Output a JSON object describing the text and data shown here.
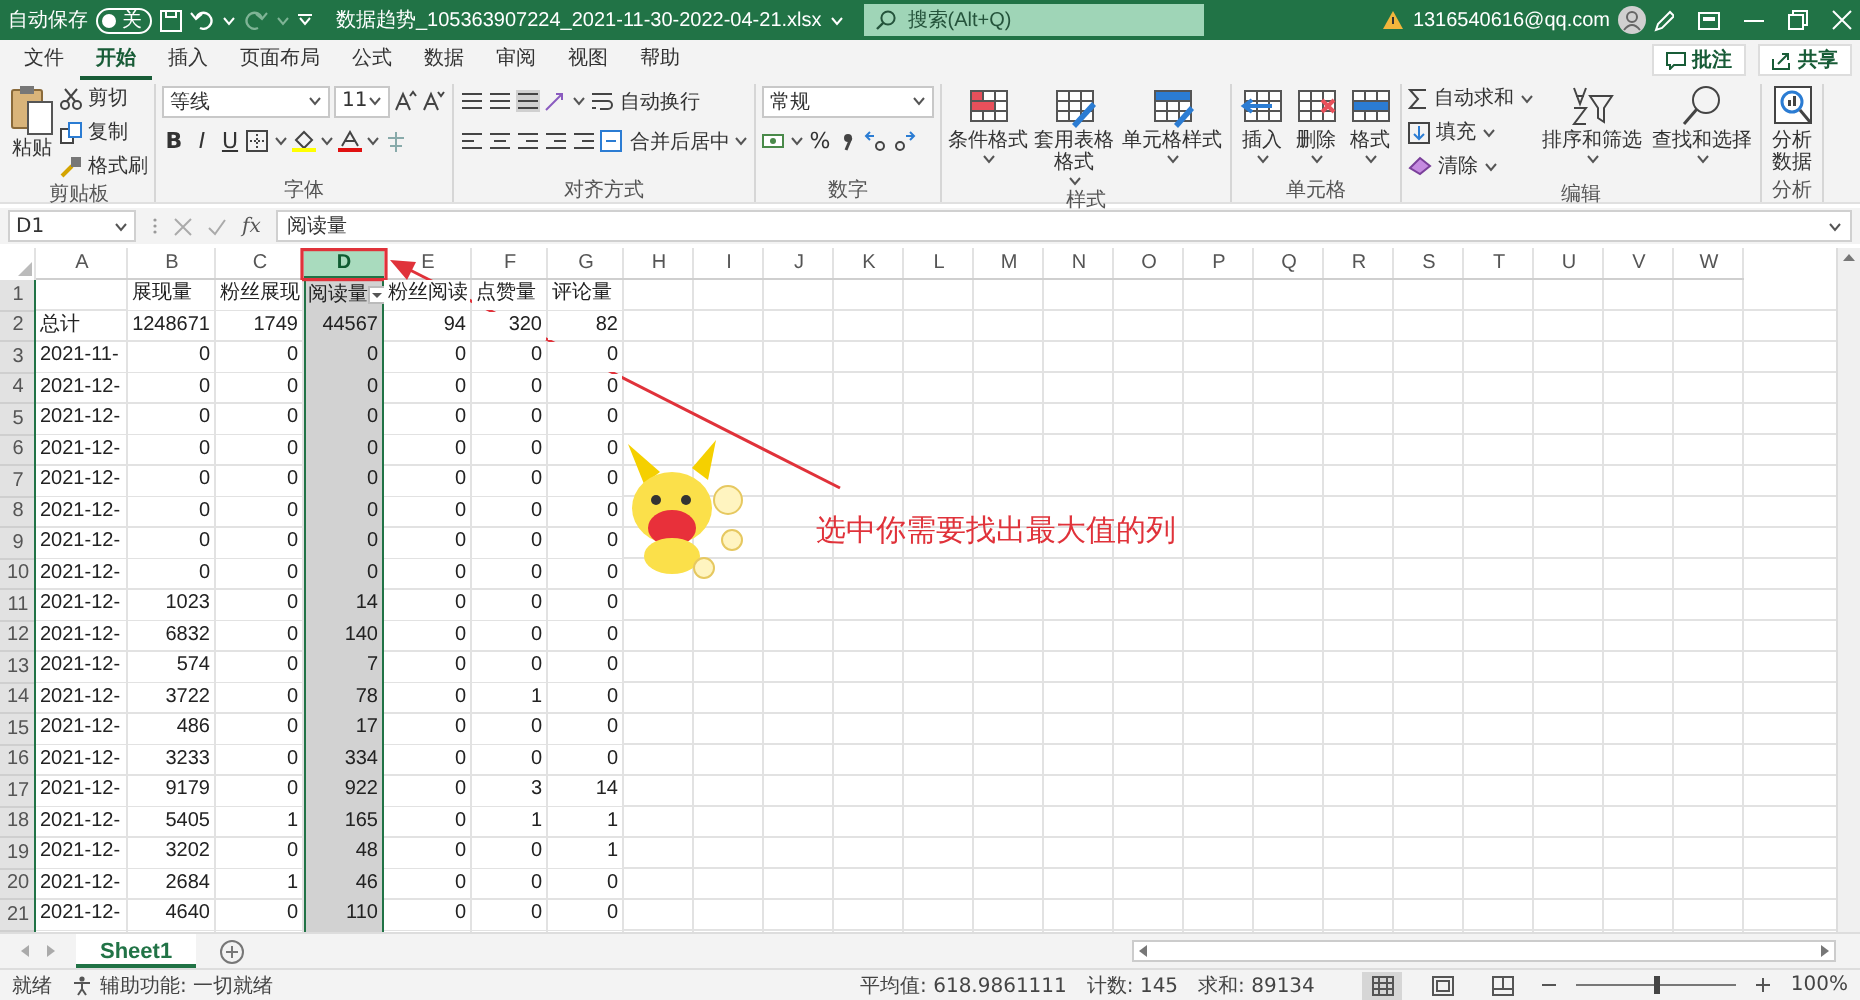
{
  "title_bar": {
    "autosave_label": "自动保存",
    "autosave": {
      "on": false,
      "label": "关"
    },
    "file_name": "数据趋势_105363907224_2021-11-30-2022-04-21.xlsx",
    "search": {
      "placeholder": "搜索(Alt+Q)"
    },
    "account": "1316540616@qq.com"
  },
  "ribbon_tabs": [
    {
      "label": "文件",
      "selected": false
    },
    {
      "label": "开始",
      "selected": true
    },
    {
      "label": "插入",
      "selected": false
    },
    {
      "label": "页面布局",
      "selected": false
    },
    {
      "label": "公式",
      "selected": false
    },
    {
      "label": "数据",
      "selected": false
    },
    {
      "label": "审阅",
      "selected": false
    },
    {
      "label": "视图",
      "selected": false
    },
    {
      "label": "帮助",
      "selected": false
    }
  ],
  "ribbon_actions": [
    "批注",
    "共享"
  ],
  "ribbon": {
    "groups": [
      {
        "kind": "clipboard",
        "name": "剪贴板",
        "large": "粘贴",
        "small": [
          "剪切",
          "复制",
          "格式刷"
        ]
      },
      {
        "kind": "font",
        "name": "字体",
        "font": "等线",
        "size": "11",
        "styles": [
          "B",
          "I",
          "U"
        ]
      },
      {
        "kind": "alignment",
        "name": "对齐方式",
        "small": [
          "自动换行",
          "合并后居中"
        ]
      },
      {
        "kind": "number",
        "name": "数字",
        "format": "常规",
        "symbols": [
          "%"
        ]
      },
      {
        "kind": "styles",
        "name": "样式",
        "large": [
          "条件格式",
          "套用表格格式",
          "单元格样式"
        ]
      },
      {
        "kind": "cells",
        "name": "单元格",
        "large": [
          "插入",
          "删除",
          "格式"
        ]
      },
      {
        "kind": "editing",
        "name": "编辑",
        "small": [
          "自动求和",
          "填充",
          "清除"
        ],
        "large": [
          "排序和筛选",
          "查找和选择"
        ]
      },
      {
        "kind": "analysis",
        "name": "分析",
        "large": [
          "分析数据"
        ]
      }
    ]
  },
  "formula_bar": {
    "name_box": "D1",
    "function_label": "fx",
    "content": "阅读量"
  },
  "sheet": {
    "columns": [
      {
        "letter": "A",
        "selected": false
      },
      {
        "letter": "B",
        "selected": false
      },
      {
        "letter": "C",
        "selected": false
      },
      {
        "letter": "D",
        "selected": true,
        "filter": true
      },
      {
        "letter": "E",
        "selected": false
      },
      {
        "letter": "F",
        "selected": false
      },
      {
        "letter": "G",
        "selected": false
      },
      {
        "letter": "H",
        "selected": false
      },
      {
        "letter": "I",
        "selected": false
      },
      {
        "letter": "J",
        "selected": false
      },
      {
        "letter": "K",
        "selected": false
      },
      {
        "letter": "L",
        "selected": false
      },
      {
        "letter": "M",
        "selected": false
      },
      {
        "letter": "N",
        "selected": false
      },
      {
        "letter": "O",
        "selected": false
      },
      {
        "letter": "P",
        "selected": false
      },
      {
        "letter": "Q",
        "selected": false
      },
      {
        "letter": "R",
        "selected": false
      },
      {
        "letter": "S",
        "selected": false
      },
      {
        "letter": "T",
        "selected": false
      },
      {
        "letter": "U",
        "selected": false
      },
      {
        "letter": "V",
        "selected": false
      },
      {
        "letter": "W",
        "selected": false
      }
    ],
    "rows": [
      {
        "number": "1",
        "kind": "header",
        "values": [
          "展现量",
          "粉丝展现",
          "阅读量",
          "粉丝阅读",
          "点赞量",
          "评论量"
        ]
      },
      {
        "number": "2",
        "kind": "data",
        "label": "总计",
        "values": [
          "1248671",
          "1749",
          "44567",
          "94",
          "320",
          "82"
        ]
      },
      {
        "number": "3",
        "kind": "data",
        "label": "2021-11-",
        "values": [
          "0",
          "0",
          "0",
          "0",
          "0",
          "0"
        ]
      },
      {
        "number": "4",
        "kind": "data",
        "label": "2021-12-",
        "values": [
          "0",
          "0",
          "0",
          "0",
          "0",
          "0"
        ]
      },
      {
        "number": "5",
        "kind": "data",
        "label": "2021-12-",
        "values": [
          "0",
          "0",
          "0",
          "0",
          "0",
          "0"
        ]
      },
      {
        "number": "6",
        "kind": "data",
        "label": "2021-12-",
        "values": [
          "0",
          "0",
          "0",
          "0",
          "0",
          "0"
        ]
      },
      {
        "number": "7",
        "kind": "data",
        "label": "2021-12-",
        "values": [
          "0",
          "0",
          "0",
          "0",
          "0",
          "0"
        ]
      },
      {
        "number": "8",
        "kind": "data",
        "label": "2021-12-",
        "values": [
          "0",
          "0",
          "0",
          "0",
          "0",
          "0"
        ]
      },
      {
        "number": "9",
        "kind": "data",
        "label": "2021-12-",
        "values": [
          "0",
          "0",
          "0",
          "0",
          "0",
          "0"
        ]
      },
      {
        "number": "10",
        "kind": "data",
        "label": "2021-12-",
        "values": [
          "0",
          "0",
          "0",
          "0",
          "0",
          "0"
        ]
      },
      {
        "number": "11",
        "kind": "data",
        "label": "2021-12-",
        "values": [
          "1023",
          "0",
          "14",
          "0",
          "0",
          "0"
        ]
      },
      {
        "number": "12",
        "kind": "data",
        "label": "2021-12-",
        "values": [
          "6832",
          "0",
          "140",
          "0",
          "0",
          "0"
        ]
      },
      {
        "number": "13",
        "kind": "data",
        "label": "2021-12-",
        "values": [
          "574",
          "0",
          "7",
          "0",
          "0",
          "0"
        ]
      },
      {
        "number": "14",
        "kind": "data",
        "label": "2021-12-",
        "values": [
          "3722",
          "0",
          "78",
          "0",
          "1",
          "0"
        ]
      },
      {
        "number": "15",
        "kind": "data",
        "label": "2021-12-",
        "values": [
          "486",
          "0",
          "17",
          "0",
          "0",
          "0"
        ]
      },
      {
        "number": "16",
        "kind": "data",
        "label": "2021-12-",
        "values": [
          "3233",
          "0",
          "334",
          "0",
          "0",
          "0"
        ]
      },
      {
        "number": "17",
        "kind": "data",
        "label": "2021-12-",
        "values": [
          "9179",
          "0",
          "922",
          "0",
          "3",
          "14"
        ]
      },
      {
        "number": "18",
        "kind": "data",
        "label": "2021-12-",
        "values": [
          "5405",
          "1",
          "165",
          "0",
          "1",
          "1"
        ]
      },
      {
        "number": "19",
        "kind": "data",
        "label": "2021-12-",
        "values": [
          "3202",
          "0",
          "48",
          "0",
          "0",
          "1"
        ]
      },
      {
        "number": "20",
        "kind": "data",
        "label": "2021-12-",
        "values": [
          "2684",
          "1",
          "46",
          "0",
          "0",
          "0"
        ]
      },
      {
        "number": "21",
        "kind": "data",
        "label": "2021-12-",
        "values": [
          "4640",
          "0",
          "110",
          "0",
          "0",
          "0"
        ]
      }
    ],
    "annotation": {
      "text": "选中你需要找出最大值的列"
    }
  },
  "sheet_tabs": [
    {
      "label": "Sheet1",
      "selected": true
    }
  ],
  "status_bar": {
    "ready": "就绪",
    "accessibility": "辅助功能: 一切就绪",
    "average": "平均值: 618.9861111",
    "count": "计数: 145",
    "sum": "求和: 89134",
    "views": [
      {
        "selected": true
      },
      {
        "selected": false
      },
      {
        "selected": false
      }
    ],
    "zoom": {
      "level": 0.5
    },
    "zoom_label": "100%"
  }
}
